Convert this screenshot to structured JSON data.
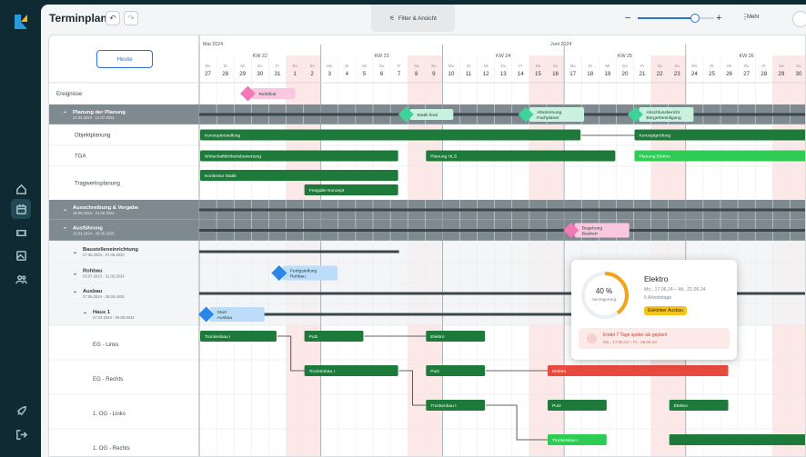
{
  "app": {
    "title": "Terminplan",
    "filter_label": "Filter & Ansicht",
    "more_label": "Mehr",
    "zoom_level": 0.75,
    "colors": {
      "rail": "#0f2a33",
      "accent": "#2a73d9",
      "bar_green": "#1e7a3a",
      "bar_light": "#2ecc55",
      "group": "#7e8a8f",
      "milestone_pink": "#f07ab5",
      "milestone_green": "#3ed39a",
      "milestone_blue": "#2a86ea",
      "overdue": "#e84a3d",
      "weekend": "#fde8e8"
    }
  },
  "rail": [
    "home-icon",
    "calendar-icon",
    "ticket-icon",
    "image-icon",
    "users-icon",
    "rocket-icon",
    "logout-icon"
  ],
  "today_button": "Heute",
  "timeline": {
    "months": [
      {
        "label": "Mai 2024",
        "col": 0
      },
      {
        "label": "Juni 2024",
        "col": 20
      }
    ],
    "weeks": [
      {
        "label": "KW 22",
        "col": 0
      },
      {
        "label": "KW 23",
        "col": 7
      },
      {
        "label": "KW 24",
        "col": 14
      },
      {
        "label": "KW 25",
        "col": 21
      },
      {
        "label": "KW 26",
        "col": 28
      }
    ],
    "days": [
      [
        "Mo",
        "27"
      ],
      [
        "Di",
        "28"
      ],
      [
        "Mi",
        "29"
      ],
      [
        "Do",
        "30"
      ],
      [
        "Fr",
        "31"
      ],
      [
        "Sa",
        "1"
      ],
      [
        "So",
        "2"
      ],
      [
        "Mo",
        "3"
      ],
      [
        "Di",
        "4"
      ],
      [
        "Mi",
        "5"
      ],
      [
        "Do",
        "6"
      ],
      [
        "Fr",
        "7"
      ],
      [
        "Sa",
        "8"
      ],
      [
        "So",
        "9"
      ],
      [
        "Mo",
        "10"
      ],
      [
        "Di",
        "11"
      ],
      [
        "Mi",
        "12"
      ],
      [
        "Do",
        "13"
      ],
      [
        "Fr",
        "14"
      ],
      [
        "Sa",
        "15"
      ],
      [
        "So",
        "16"
      ],
      [
        "Mo",
        "17"
      ],
      [
        "Di",
        "18"
      ],
      [
        "Mi",
        "19"
      ],
      [
        "Do",
        "20"
      ],
      [
        "Fr",
        "21"
      ],
      [
        "Sa",
        "22"
      ],
      [
        "So",
        "23"
      ],
      [
        "Mo",
        "24"
      ],
      [
        "Di",
        "25"
      ],
      [
        "Mi",
        "26"
      ],
      [
        "Do",
        "27"
      ],
      [
        "Fr",
        "28"
      ],
      [
        "Sa",
        "29"
      ],
      [
        "So",
        "30"
      ]
    ]
  },
  "rows": [
    {
      "label": "Ereignisse",
      "kind": "plain",
      "h": 24
    },
    {
      "label": "Planung der Planung",
      "dates": "22.03.2023 - 12.07.2024",
      "kind": "group",
      "h": 22,
      "caret": "up"
    },
    {
      "label": "Objektplanung",
      "kind": "item",
      "h": 23
    },
    {
      "label": "TGA",
      "kind": "item",
      "h": 23
    },
    {
      "label": "Tragwerksplanung",
      "kind": "item",
      "h": 37
    },
    {
      "label": "Ausschreibung & Vergabe",
      "dates": "18.09.2023 - 21.06.2024",
      "kind": "group",
      "h": 22,
      "caret": "down"
    },
    {
      "label": "Ausführung",
      "dates": "15.04.2024 - 28.05.2025",
      "kind": "group",
      "h": 23,
      "caret": "up"
    },
    {
      "label": "Baustelleneinrichtung",
      "dates": "27.05.2023 - 07.06.2023",
      "kind": "sub",
      "h": 24,
      "caret": "down"
    },
    {
      "label": "Rohbau",
      "dates": "03.07.2023 - 31.05.2024",
      "kind": "sub",
      "h": 23,
      "caret": "down"
    },
    {
      "label": "Ausbau",
      "dates": "27.06.2024 - 28.05.2025",
      "kind": "sub",
      "h": 22,
      "caret": "up"
    },
    {
      "label": "Haus 1",
      "dates": "27.03.2024 - 06.09.2024",
      "kind": "sub2",
      "h": 24,
      "caret": "up"
    },
    {
      "label": "EG - Links",
      "kind": "item2",
      "h": 38
    },
    {
      "label": "EG - Rechts",
      "kind": "item2",
      "h": 38
    },
    {
      "label": "1. OG - Links",
      "kind": "item2",
      "h": 38
    },
    {
      "label": "1. OG - Rechts",
      "kind": "item2",
      "h": 38
    }
  ],
  "bars": [
    {
      "row": 1,
      "s": 0,
      "e": 35,
      "style": "summary"
    },
    {
      "row": 2,
      "s": 0,
      "e": 22,
      "style": "green",
      "label": "Konzepterstellung"
    },
    {
      "row": 2,
      "s": 25,
      "e": 35,
      "style": "green",
      "label": "Konzeptprüfung"
    },
    {
      "row": 3,
      "s": 0,
      "e": 11.5,
      "style": "green",
      "label": "Wirtschaftlichkeitsbewertung"
    },
    {
      "row": 3,
      "s": 13,
      "e": 24,
      "style": "green",
      "label": "Planung HLS"
    },
    {
      "row": 3,
      "s": 25,
      "e": 35,
      "style": "light",
      "label": "Planung Elektro"
    },
    {
      "row": 4,
      "s": 0,
      "e": 11.5,
      "style": "green",
      "label": "Konkretur Statik",
      "y": 4
    },
    {
      "row": 4,
      "s": 6,
      "e": 11.5,
      "style": "green",
      "label": "Freigabe Konzept",
      "y": 20
    },
    {
      "row": 5,
      "s": 0,
      "e": 35,
      "style": "summary"
    },
    {
      "row": 6,
      "s": 0,
      "e": 35,
      "style": "summary"
    },
    {
      "row": 7,
      "s": 0,
      "e": 11.5,
      "style": "summary"
    },
    {
      "row": 9,
      "s": 0,
      "e": 35,
      "style": "summary"
    },
    {
      "row": 10,
      "s": 0,
      "e": 30.5,
      "style": "summary"
    },
    {
      "row": 11,
      "s": 0,
      "e": 4.5,
      "style": "green",
      "label": "Trockenbau I"
    },
    {
      "row": 11,
      "s": 6,
      "e": 9.5,
      "style": "green",
      "label": "Putz"
    },
    {
      "row": 11,
      "s": 13,
      "e": 16.5,
      "style": "green",
      "label": "Elektro"
    },
    {
      "row": 12,
      "s": 6,
      "e": 11.5,
      "style": "green",
      "label": "Trockenbau I"
    },
    {
      "row": 12,
      "s": 13,
      "e": 16.5,
      "style": "green",
      "label": "Putz"
    },
    {
      "row": 12,
      "s": 20,
      "e": 30.5,
      "style": "red",
      "label": "Elektro"
    },
    {
      "row": 13,
      "s": 13,
      "e": 16.5,
      "style": "green",
      "label": "Trockenbau I"
    },
    {
      "row": 13,
      "s": 20,
      "e": 23.5,
      "style": "green",
      "label": "Putz"
    },
    {
      "row": 13,
      "s": 27,
      "e": 30.5,
      "style": "green",
      "label": "Elektro"
    },
    {
      "row": 14,
      "s": 20,
      "e": 23.5,
      "style": "light",
      "label": "Trockenbau I"
    },
    {
      "row": 14,
      "s": 27,
      "e": 35,
      "style": "green",
      "label": ""
    }
  ],
  "milestones": [
    {
      "row": 0,
      "col": 2.8,
      "color": "pink",
      "label": "Richtfest",
      "icon": "lock-icon"
    },
    {
      "row": 1,
      "col": 11.9,
      "color": "mint",
      "label": "Statik final"
    },
    {
      "row": 1,
      "col": 18.8,
      "color": "mint",
      "label": "Abstimmung",
      "label2": "Fachplaner"
    },
    {
      "row": 1,
      "col": 25.1,
      "color": "mint",
      "label": "Abschlussbericht",
      "label2": "Bürgerbeteiligung"
    },
    {
      "row": 6,
      "col": 21.4,
      "color": "pink",
      "label": "Begehung",
      "label2": "Bauherr"
    },
    {
      "row": 8,
      "col": 4.6,
      "color": "blue",
      "label": "Fertigstellung",
      "label2": "Rohbau"
    },
    {
      "row": 10,
      "col": 0.4,
      "color": "blue",
      "label": "Start",
      "label2": "Ausbau"
    }
  ],
  "popup": {
    "title": "Elektro",
    "percent": "40 %",
    "percent_value": 40,
    "percent_label": "Verzögerung",
    "dates": "Mo., 17.06.24 – Mi., 21.06.24",
    "duration": "5 Arbeitstage",
    "badge": "Elektriker Ausbau",
    "warning": "Endet 7 Tage später als geplant",
    "warning_dates": "Mo., 17.06.24 – Fr., 28.06.24"
  }
}
